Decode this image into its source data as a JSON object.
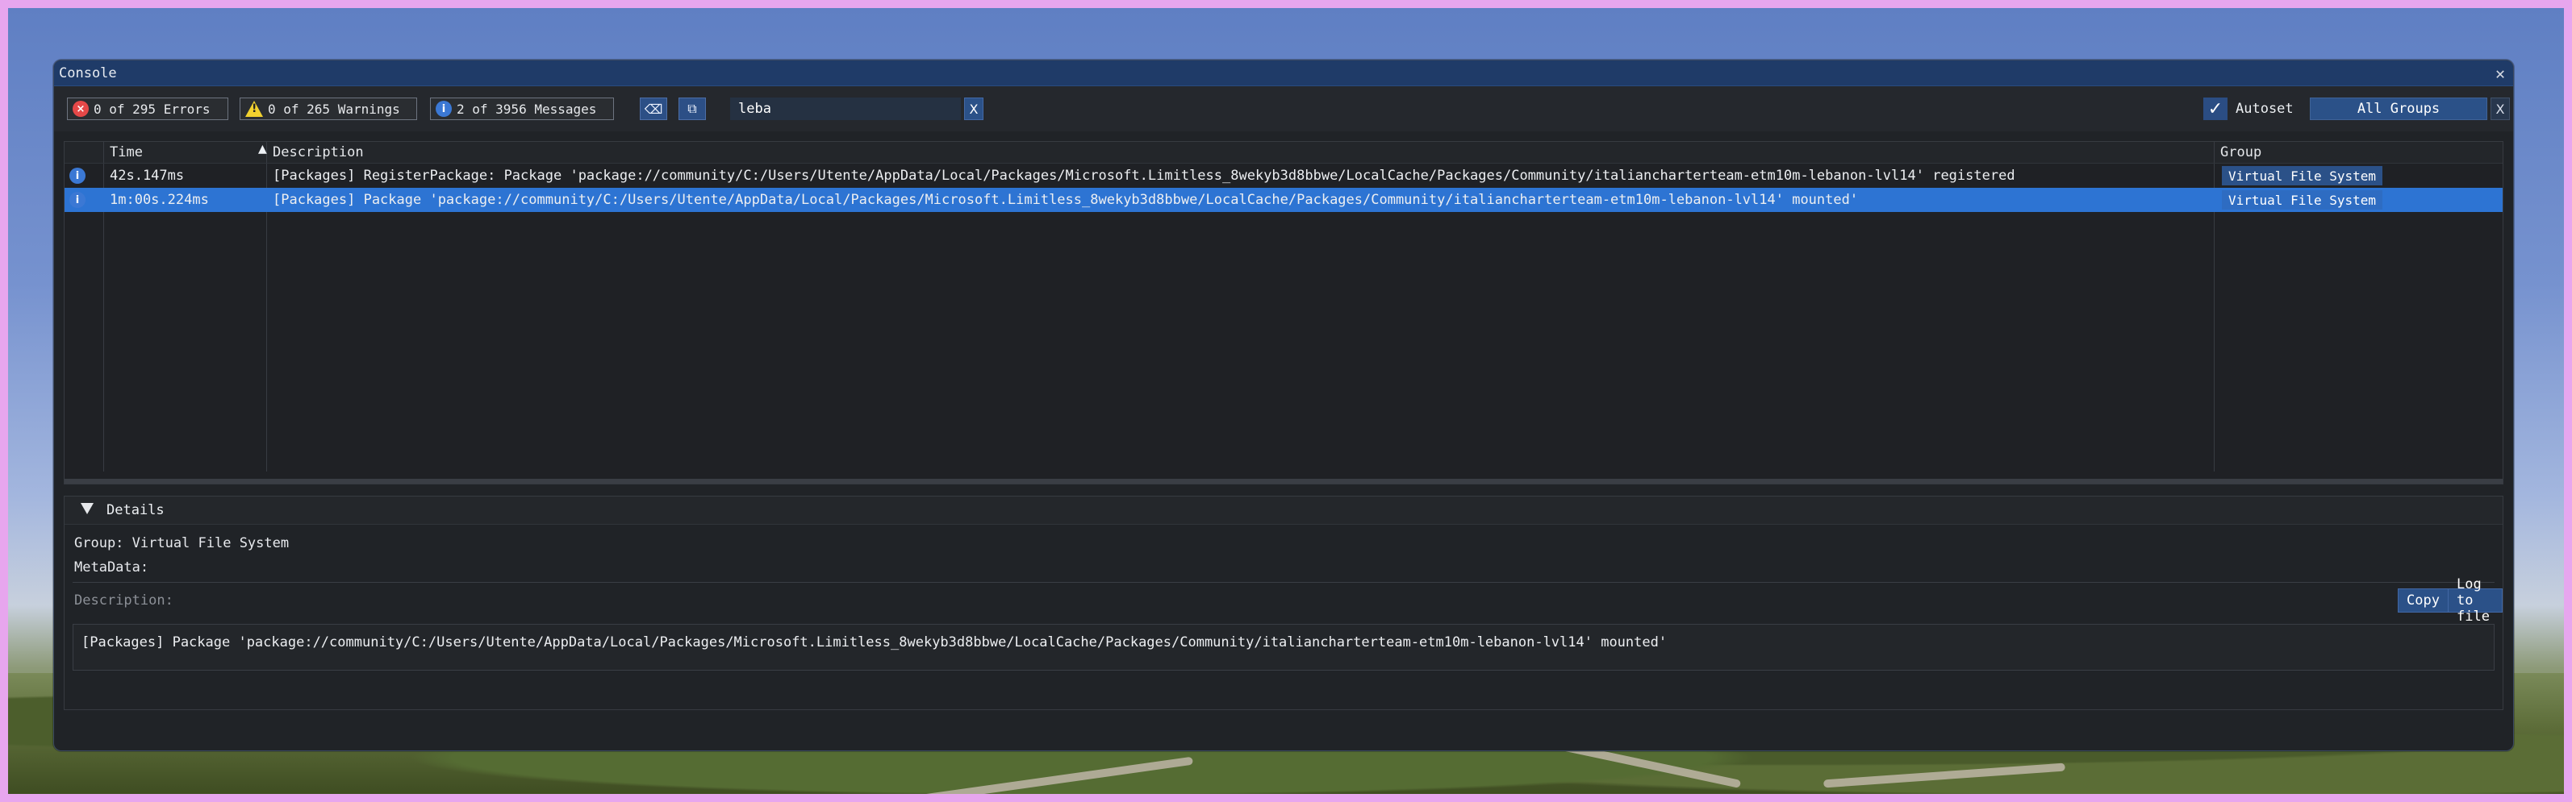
{
  "window": {
    "title": "Console",
    "close_label": "✕"
  },
  "toolbar": {
    "errors": "0 of 295 Errors",
    "warnings": "0 of 265 Warnings",
    "messages": "2 of 3956 Messages",
    "search_value": "leba",
    "clear_search_label": "X",
    "autoset_label": "Autoset",
    "autoset_checked": true,
    "group_filter": "All Groups",
    "clear_group_label": "X"
  },
  "table": {
    "headers": {
      "time": "Time",
      "description": "Description",
      "group": "Group"
    },
    "rows": [
      {
        "icon": "info-icon",
        "time": "42s.147ms",
        "description": "[Packages] RegisterPackage: Package 'package://community/C:/Users/Utente/AppData/Local/Packages/Microsoft.Limitless_8wekyb3d8bbwe/LocalCache/Packages/Community/italiancharterteam-etm10m-lebanon-lvl14' registered",
        "group": "Virtual File System",
        "selected": false
      },
      {
        "icon": "info-icon",
        "time": "1m:00s.224ms",
        "description": "[Packages] Package 'package://community/C:/Users/Utente/AppData/Local/Packages/Microsoft.Limitless_8wekyb3d8bbwe/LocalCache/Packages/Community/italiancharterteam-etm10m-lebanon-lvl14' mounted'",
        "group": "Virtual File System",
        "selected": true
      }
    ]
  },
  "details": {
    "title": "Details",
    "group_line": "Group: Virtual File System",
    "metadata_line": "MetaData:",
    "description_label": "Description:",
    "copy_label": "Copy",
    "log_label": "Log to file",
    "description_text": "[Packages] Package 'package://community/C:/Users/Utente/AppData/Local/Packages/Microsoft.Limitless_8wekyb3d8bbwe/LocalCache/Packages/Community/italiancharterteam-etm10m-lebanon-lvl14' mounted'"
  },
  "colors": {
    "titlebar": "#1f3b68",
    "selected_row": "#2d74d3",
    "accent_button": "#2b5188"
  }
}
